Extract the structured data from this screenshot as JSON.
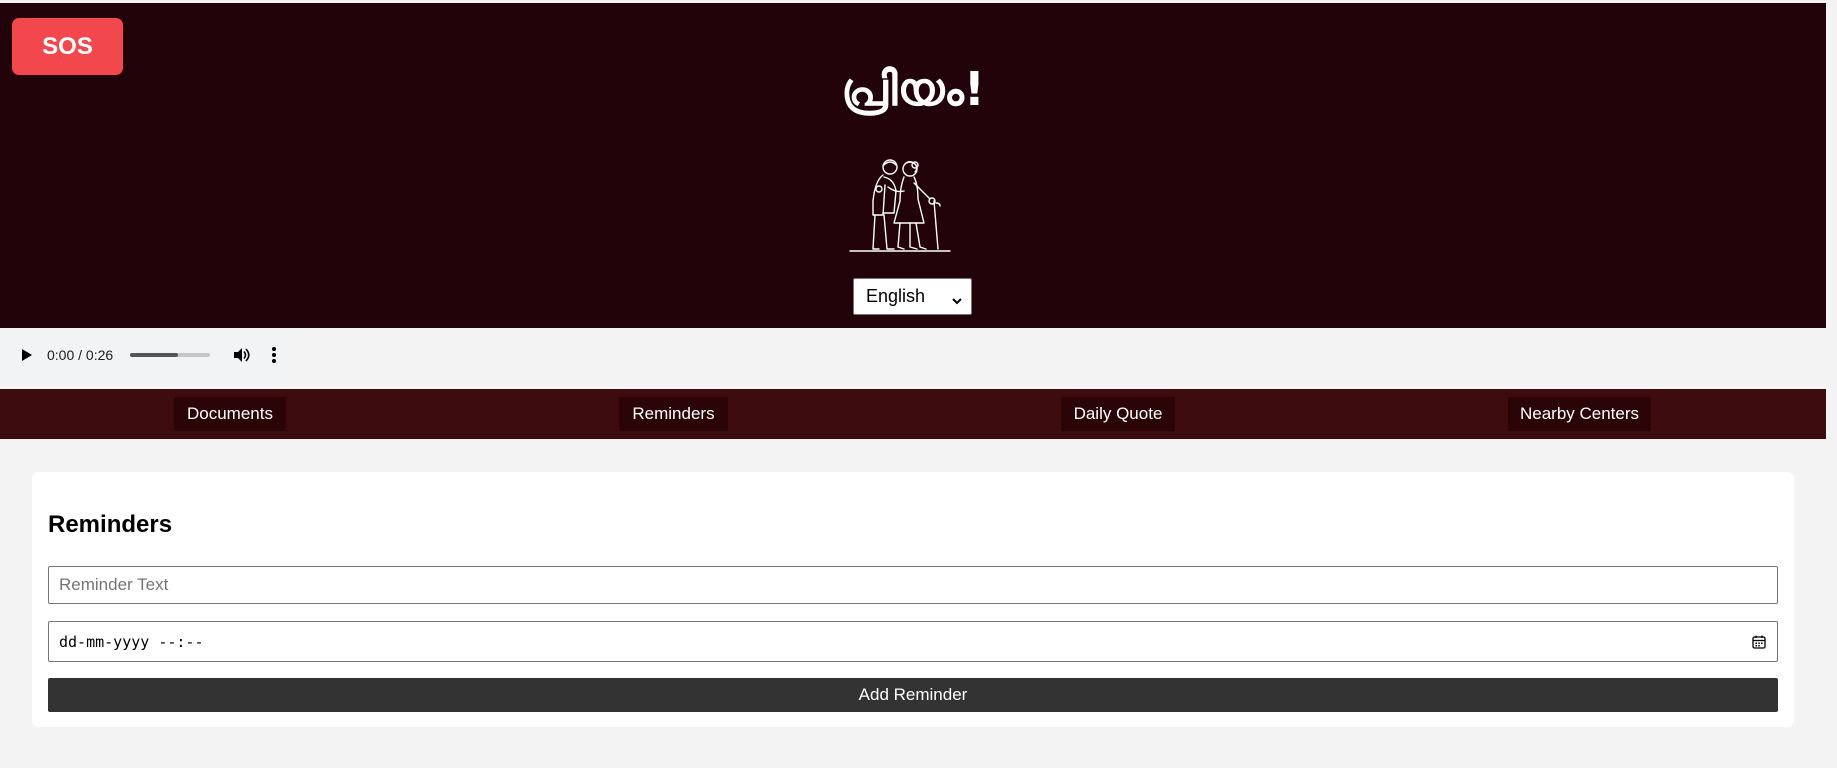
{
  "header": {
    "sos_label": "SOS",
    "title": "പ്രിയം!",
    "illustration_icon": "elderly-couple-icon",
    "language_select": {
      "selected": "English"
    }
  },
  "audio_player": {
    "time": "0:00 / 0:26",
    "volume_progress": 0.6,
    "icons": [
      "play-icon",
      "volume-icon",
      "more-options-icon"
    ]
  },
  "nav": {
    "items": [
      {
        "label": "Documents"
      },
      {
        "label": "Reminders"
      },
      {
        "label": "Daily Quote"
      },
      {
        "label": "Nearby Centers"
      }
    ]
  },
  "reminders": {
    "title": "Reminders",
    "text_placeholder": "Reminder Text",
    "datetime_placeholder": "dd-mm-yyyy --:--",
    "add_label": "Add Reminder"
  },
  "colors": {
    "header_bg": "#210309",
    "nav_bg": "#3d0c0e",
    "nav_button_bg": "#2a0406",
    "sos_bg": "#f2474d",
    "add_button_bg": "#333333",
    "page_bg": "#f3f3f3"
  }
}
